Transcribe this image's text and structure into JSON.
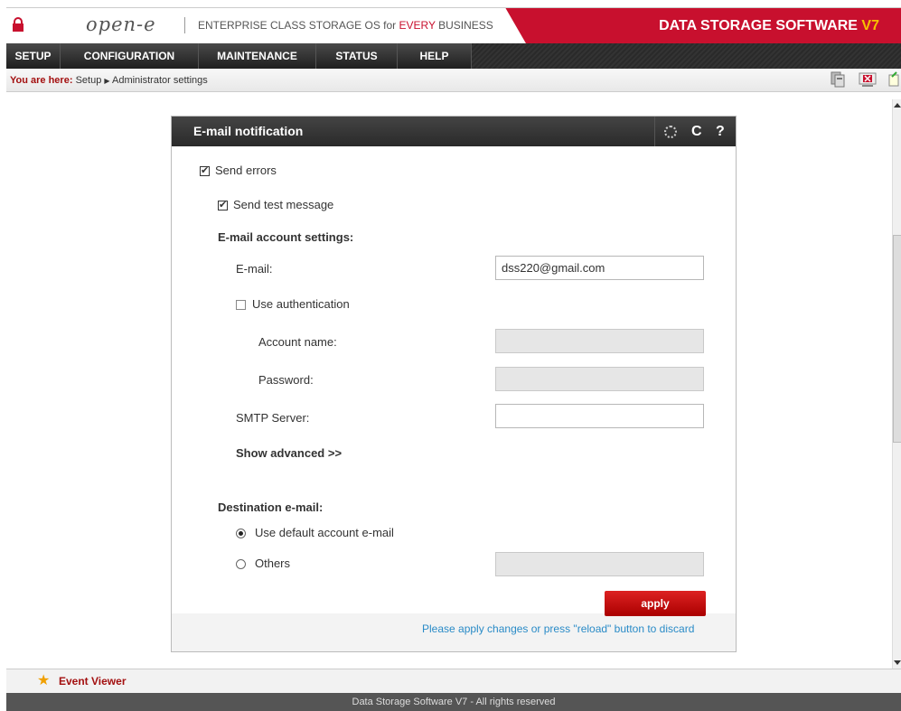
{
  "header": {
    "logo": "open-e",
    "tagline_prefix": "ENTERPRISE CLASS STORAGE OS for ",
    "tagline_highlight": "EVERY",
    "tagline_suffix": " BUSINESS",
    "product": "DATA STORAGE SOFTWARE ",
    "product_version": "V7"
  },
  "nav": {
    "items": [
      {
        "label": "SETUP"
      },
      {
        "label": "CONFIGURATION"
      },
      {
        "label": "MAINTENANCE"
      },
      {
        "label": "STATUS"
      },
      {
        "label": "HELP"
      }
    ]
  },
  "breadcrumb": {
    "you_are_here": "You are here:",
    "path": "Setup",
    "current": "Administrator settings"
  },
  "panel": {
    "title": "E-mail notification",
    "send_errors": "Send errors",
    "send_test": "Send test message",
    "account_settings": "E-mail account settings:",
    "email_label": "E-mail:",
    "email_value": "dss220@gmail.com",
    "use_auth": "Use authentication",
    "account_name_label": "Account name:",
    "password_label": "Password:",
    "smtp_label": "SMTP Server:",
    "smtp_value": "",
    "show_advanced": "Show advanced >>",
    "destination": "Destination e-mail:",
    "use_default": "Use default account e-mail",
    "others": "Others",
    "apply": "apply",
    "hint": "Please apply changes or press \"reload\" button to discard",
    "reload_icon_char": "C",
    "help_icon_char": "?"
  },
  "event_viewer": "Event Viewer",
  "footer": "Data Storage Software V7 - All rights reserved"
}
